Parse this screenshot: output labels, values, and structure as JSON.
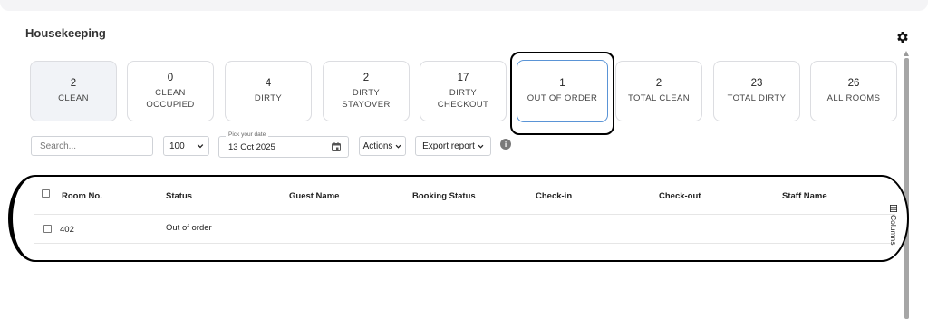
{
  "page": {
    "title": "Housekeeping"
  },
  "icons": {
    "settings": "gear-icon",
    "calendar": "calendar-icon",
    "info": "info-icon",
    "columns": "columns-icon"
  },
  "status_cards": [
    {
      "count": "2",
      "label": [
        "CLEAN"
      ]
    },
    {
      "count": "0",
      "label": [
        "CLEAN",
        "OCCUPIED"
      ]
    },
    {
      "count": "4",
      "label": [
        "DIRTY"
      ]
    },
    {
      "count": "2",
      "label": [
        "DIRTY",
        "STAYOVER"
      ]
    },
    {
      "count": "17",
      "label": [
        "DIRTY",
        "CHECKOUT"
      ]
    },
    {
      "count": "1",
      "label": [
        "OUT OF ORDER"
      ]
    },
    {
      "count": "2",
      "label": [
        "TOTAL CLEAN"
      ]
    },
    {
      "count": "23",
      "label": [
        "TOTAL DIRTY"
      ]
    },
    {
      "count": "26",
      "label": [
        "ALL ROOMS"
      ]
    }
  ],
  "toolbar": {
    "search_placeholder": "Search...",
    "page_size": "100",
    "date_label": "Pick your date",
    "date_value": "13 Oct 2025",
    "actions_label": "Actions",
    "export_label": "Export report",
    "info_glyph": "i"
  },
  "table": {
    "headers": [
      "Room No.",
      "Status",
      "Guest Name",
      "Booking Status",
      "Check-in",
      "Check-out",
      "Staff Name"
    ],
    "rows": [
      {
        "room": "402",
        "status": "Out of order",
        "guest": "",
        "booking": "",
        "checkin": "",
        "checkout": "",
        "staff": ""
      }
    ],
    "columns_label": "Columns"
  }
}
